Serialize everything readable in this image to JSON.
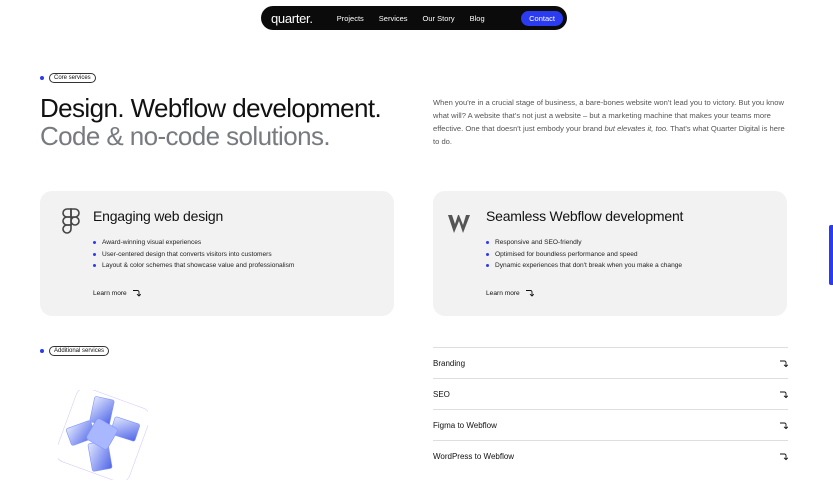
{
  "nav": {
    "logo": "quarter.",
    "links": [
      "Projects",
      "Services",
      "Our Story",
      "Blog"
    ],
    "contact": "Contact"
  },
  "core": {
    "label": "Core services",
    "headline_1": "Design. Webflow development.",
    "headline_2": "Code & no-code solutions.",
    "intro_1": "When you're in a crucial stage of business, a bare-bones website won't lead you to victory. But you know what will? A website that's not just a website – but a marketing machine that makes your teams more effective. One that doesn't just embody your brand ",
    "intro_italic": "but elevates it, too.",
    "intro_2": " That's what Quarter Digital is here to do."
  },
  "cards": [
    {
      "icon": "figma-icon",
      "title": "Engaging web design",
      "points": [
        "Award-winning visual experiences",
        "User-centered design that converts visitors into customers",
        "Layout & color schemes that showcase value and professionalism"
      ],
      "link": "Learn more"
    },
    {
      "icon": "webflow-icon",
      "title": "Seamless Webflow development",
      "points": [
        "Responsive and SEO-friendly",
        "Optimised for boundless performance and speed",
        "Dynamic experiences that don't break when you make a change"
      ],
      "link": "Learn more"
    }
  ],
  "additional": {
    "label": "Additional services",
    "items": [
      "Branding",
      "SEO",
      "Figma to Webflow",
      "WordPress to Webflow"
    ]
  },
  "colors": {
    "accent": "#2b3bf0",
    "card_bg": "#f2f2f2",
    "nav_bg": "#0b0b0b"
  }
}
